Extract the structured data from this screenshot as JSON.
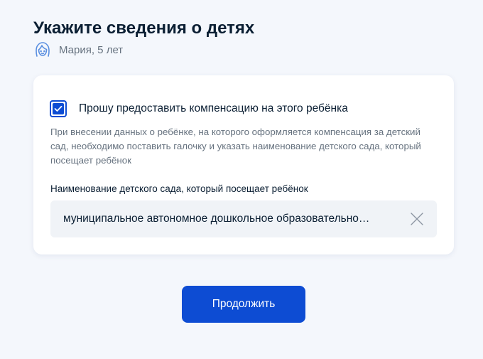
{
  "page": {
    "title": "Укажите сведения о детях"
  },
  "child": {
    "avatar_icon": "girl-avatar-icon",
    "name": "Мария, 5 лет"
  },
  "compensation": {
    "checkbox_checked": true,
    "checkbox_label": "Прошу предоставить компенсацию на этого ребёнка",
    "hint": "При внесении данных о ребёнке, на которого оформляется компенсация за детский сад, необходимо поставить галочку и указать наименование детского сада, который посещает ребёнок"
  },
  "kindergarten": {
    "label": "Наименование детского сада, который посещает ребёнок",
    "value": "муниципальное автономное дошкольное образовательно…",
    "clear_icon": "close-icon"
  },
  "actions": {
    "continue_label": "Продолжить"
  },
  "colors": {
    "accent": "#0d4cd3",
    "background": "#f4f7fc",
    "text": "#0b1f33",
    "secondary_text": "#66727f",
    "field_background": "#f0f3f7"
  }
}
